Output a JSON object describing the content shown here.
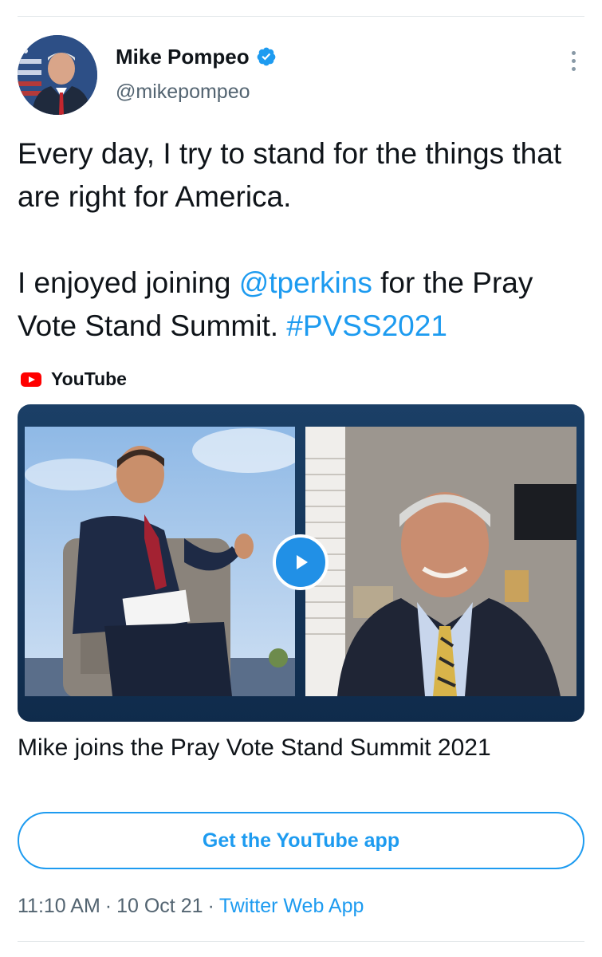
{
  "author": {
    "display_name": "Mike Pompeo",
    "handle": "@mikepompeo",
    "verified": true
  },
  "tweet": {
    "line1": "Every day, I try to stand for the things that are right for America.",
    "line2_before": "I enjoyed joining ",
    "mention": "@tperkins",
    "line2_middle": " for the Pray Vote Stand Summit. ",
    "hashtag": "#PVSS2021"
  },
  "card": {
    "source": "YouTube",
    "title": "Mike joins the Pray Vote Stand Summit 2021",
    "app_button": "Get the YouTube app"
  },
  "meta": {
    "time": "11:10 AM",
    "date": "10 Oct 21",
    "client": "Twitter Web App"
  },
  "icons": {
    "verified": "verified-badge-icon",
    "more": "more-options-icon",
    "youtube": "youtube-logo-icon",
    "play": "play-icon"
  },
  "colors": {
    "link": "#1d9bf0",
    "muted": "#536471",
    "youtube_red": "#ff0000",
    "player_bg": "#15365a"
  }
}
